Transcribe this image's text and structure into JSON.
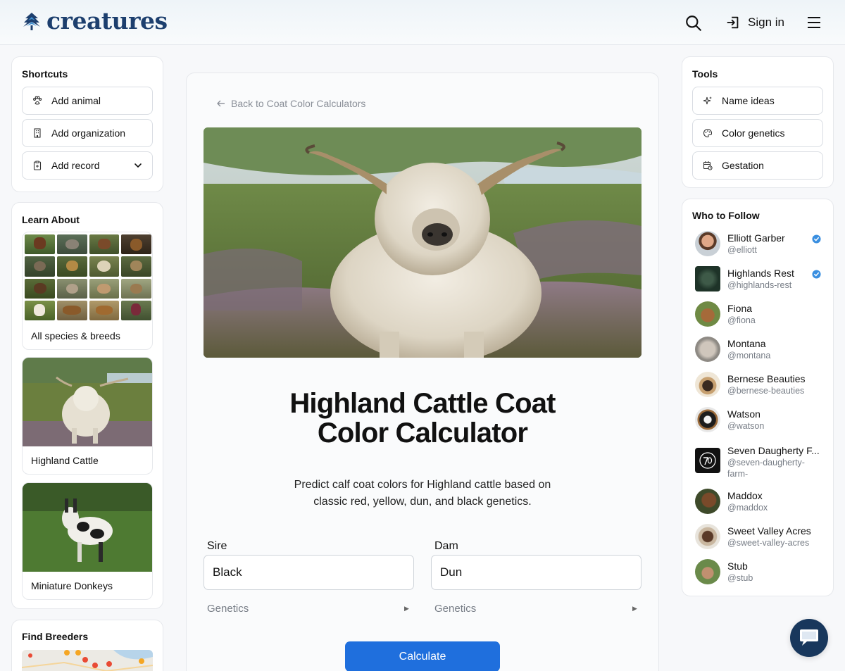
{
  "header": {
    "logo_text": "creatures",
    "signin_label": "Sign in"
  },
  "shortcuts": {
    "title": "Shortcuts",
    "items": [
      {
        "label": "Add animal",
        "icon": "paw-icon"
      },
      {
        "label": "Add organization",
        "icon": "building-icon"
      },
      {
        "label": "Add record",
        "icon": "clipboard-icon"
      }
    ]
  },
  "learn": {
    "title": "Learn About",
    "all_label": "All species & breeds",
    "featured": [
      {
        "label": "Highland Cattle"
      },
      {
        "label": "Miniature Donkeys"
      }
    ]
  },
  "breeders": {
    "title": "Find Breeders"
  },
  "main": {
    "back_label": "Back to Coat Color Calculators",
    "title_line1": "Highland Cattle Coat",
    "title_line2": "Color Calculator",
    "description": "Predict calf coat colors for Highland cattle based on classic red, yellow, dun, and black genetics.",
    "sire_label": "Sire",
    "sire_value": "Black",
    "dam_label": "Dam",
    "dam_value": "Dun",
    "genetics_label": "Genetics",
    "calculate_label": "Calculate"
  },
  "tools": {
    "title": "Tools",
    "items": [
      {
        "label": "Name ideas",
        "icon": "sparkle-icon"
      },
      {
        "label": "Color genetics",
        "icon": "palette-icon"
      },
      {
        "label": "Gestation",
        "icon": "calendar-icon"
      }
    ]
  },
  "who_to_follow": {
    "title": "Who to Follow",
    "people": [
      {
        "name": "Elliott Garber",
        "handle": "@elliott",
        "verified": true
      },
      {
        "name": "Highlands Rest",
        "handle": "@highlands-rest",
        "verified": true
      },
      {
        "name": "Fiona",
        "handle": "@fiona"
      },
      {
        "name": "Montana",
        "handle": "@montana"
      },
      {
        "name": "Bernese Beauties",
        "handle": "@bernese-beauties"
      },
      {
        "name": "Watson",
        "handle": "@watson"
      },
      {
        "name": "Seven Daugherty F...",
        "handle": "@seven-daugherty-",
        "handle2": "farm-"
      },
      {
        "name": "Maddox",
        "handle": "@maddox"
      },
      {
        "name": "Sweet Valley Acres",
        "handle": "@sweet-valley-acres"
      },
      {
        "name": "Stub",
        "handle": "@stub"
      }
    ]
  },
  "colors": {
    "brand": "#1d3f6e",
    "primary_button": "#1f6fdd",
    "chat_button": "#18375c",
    "verified": "#3a8fe0"
  }
}
